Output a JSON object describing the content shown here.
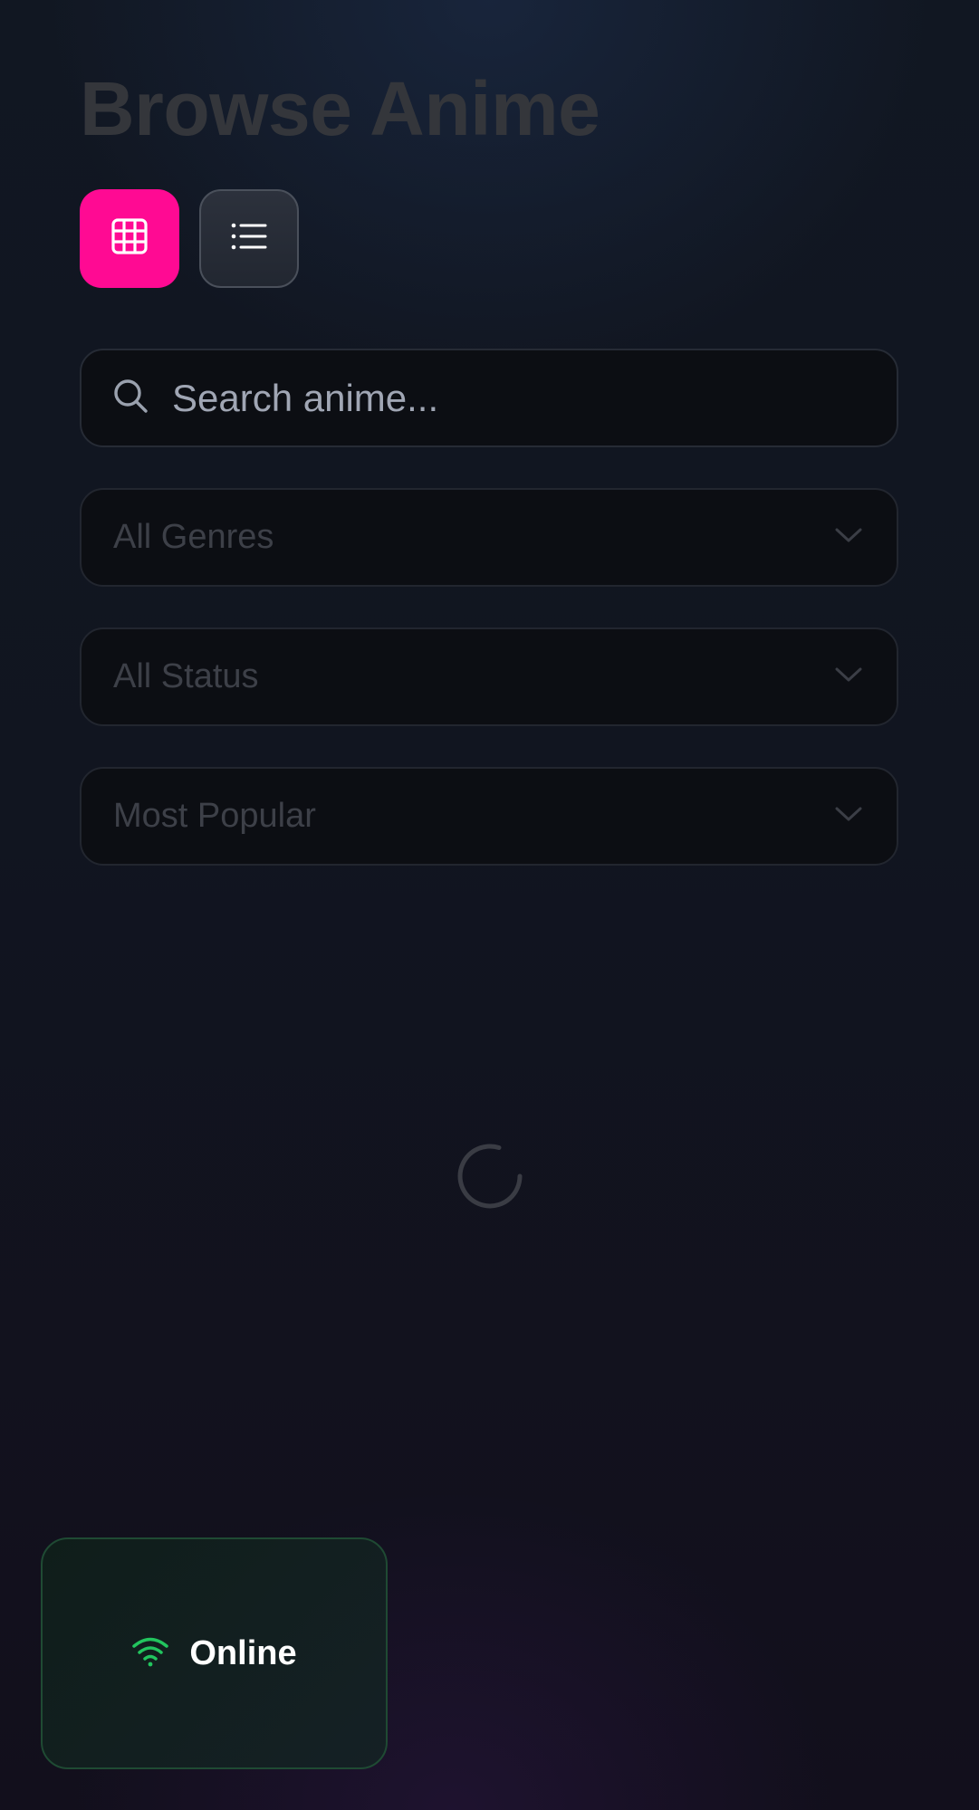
{
  "header": {
    "title": "Browse Anime"
  },
  "view_toggle": {
    "grid": {
      "icon": "grid-icon",
      "active": true
    },
    "list": {
      "icon": "list-icon",
      "active": false
    }
  },
  "search": {
    "placeholder": "Search anime...",
    "value": "",
    "icon": "search-icon"
  },
  "filters": {
    "genre": {
      "selected": "All Genres",
      "icon": "chevron-down-icon"
    },
    "status": {
      "selected": "All Status",
      "icon": "chevron-down-icon"
    },
    "sort": {
      "selected": "Most Popular",
      "icon": "chevron-down-icon"
    }
  },
  "loading": {
    "icon": "loading-spinner-icon"
  },
  "connection": {
    "label": "Online",
    "icon": "wifi-icon",
    "color": "#22c55e"
  },
  "colors": {
    "accent": "#ff0a93",
    "background": "#111520",
    "online": "#22c55e"
  }
}
